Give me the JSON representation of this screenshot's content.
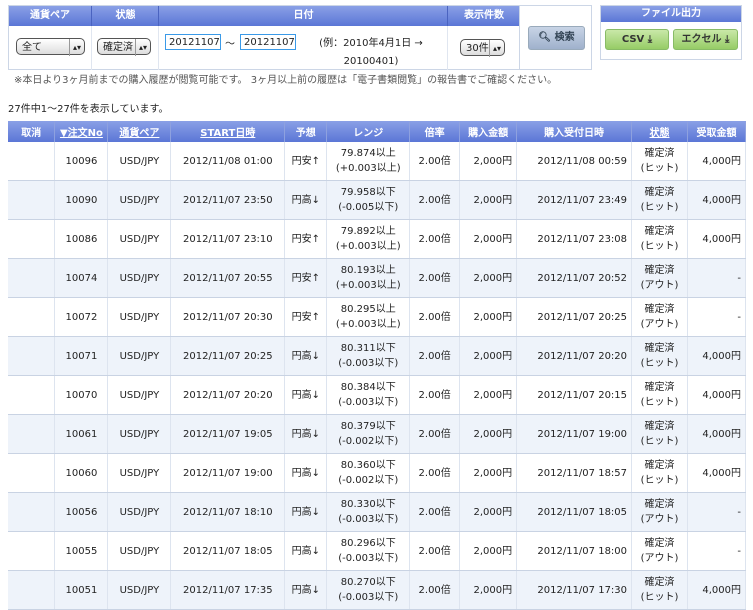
{
  "filter": {
    "headers": [
      "通貨ペア",
      "状態",
      "日付",
      "表示件数"
    ],
    "pair": "全て",
    "status": "確定済",
    "date_from": "20121107",
    "tilde": "〜",
    "date_to": "20121107",
    "example": "(例：2010年4月1日 → 20100401)",
    "count": "30件",
    "search": "検索"
  },
  "export": {
    "title": "ファイル出力",
    "csv": "CSV",
    "excel": "エクセル"
  },
  "note": "※本日より3ヶ月前までの購入履歴が閲覧可能です。 3ヶ月以上前の履歴は「電子書類閲覧」の報告書でご確認ください。",
  "summary": "27件中1〜27件を表示しています。",
  "columns": [
    "取消",
    "▼注文No",
    "通貨ペア",
    "START日時",
    "予想",
    "レンジ",
    "倍率",
    "購入金額",
    "購入受付日時",
    "状態",
    "受取金額"
  ],
  "rows": [
    [
      "",
      "10096",
      "USD/JPY",
      "2012/11/08 01:00",
      "円安↑",
      "79.874以上",
      "(+0.003以上)",
      "2.00倍",
      "2,000円",
      "2012/11/08 00:59",
      "確定済",
      "(ヒット)",
      "4,000円"
    ],
    [
      "",
      "10090",
      "USD/JPY",
      "2012/11/07 23:50",
      "円高↓",
      "79.958以下",
      "(-0.005以下)",
      "2.00倍",
      "2,000円",
      "2012/11/07 23:49",
      "確定済",
      "(ヒット)",
      "4,000円"
    ],
    [
      "",
      "10086",
      "USD/JPY",
      "2012/11/07 23:10",
      "円安↑",
      "79.892以上",
      "(+0.003以上)",
      "2.00倍",
      "2,000円",
      "2012/11/07 23:08",
      "確定済",
      "(ヒット)",
      "4,000円"
    ],
    [
      "",
      "10074",
      "USD/JPY",
      "2012/11/07 20:55",
      "円安↑",
      "80.193以上",
      "(+0.003以上)",
      "2.00倍",
      "2,000円",
      "2012/11/07 20:52",
      "確定済",
      "(アウト)",
      "-"
    ],
    [
      "",
      "10072",
      "USD/JPY",
      "2012/11/07 20:30",
      "円安↑",
      "80.295以上",
      "(+0.003以上)",
      "2.00倍",
      "2,000円",
      "2012/11/07 20:25",
      "確定済",
      "(アウト)",
      "-"
    ],
    [
      "",
      "10071",
      "USD/JPY",
      "2012/11/07 20:25",
      "円高↓",
      "80.311以下",
      "(-0.003以下)",
      "2.00倍",
      "2,000円",
      "2012/11/07 20:20",
      "確定済",
      "(ヒット)",
      "4,000円"
    ],
    [
      "",
      "10070",
      "USD/JPY",
      "2012/11/07 20:20",
      "円高↓",
      "80.384以下",
      "(-0.003以下)",
      "2.00倍",
      "2,000円",
      "2012/11/07 20:15",
      "確定済",
      "(ヒット)",
      "4,000円"
    ],
    [
      "",
      "10061",
      "USD/JPY",
      "2012/11/07 19:05",
      "円高↓",
      "80.379以下",
      "(-0.002以下)",
      "2.00倍",
      "2,000円",
      "2012/11/07 19:00",
      "確定済",
      "(ヒット)",
      "4,000円"
    ],
    [
      "",
      "10060",
      "USD/JPY",
      "2012/11/07 19:00",
      "円高↓",
      "80.360以下",
      "(-0.002以下)",
      "2.00倍",
      "2,000円",
      "2012/11/07 18:57",
      "確定済",
      "(ヒット)",
      "4,000円"
    ],
    [
      "",
      "10056",
      "USD/JPY",
      "2012/11/07 18:10",
      "円高↓",
      "80.330以下",
      "(-0.003以下)",
      "2.00倍",
      "2,000円",
      "2012/11/07 18:05",
      "確定済",
      "(アウト)",
      "-"
    ],
    [
      "",
      "10055",
      "USD/JPY",
      "2012/11/07 18:05",
      "円高↓",
      "80.296以下",
      "(-0.003以下)",
      "2.00倍",
      "2,000円",
      "2012/11/07 18:00",
      "確定済",
      "(アウト)",
      "-"
    ],
    [
      "",
      "10051",
      "USD/JPY",
      "2012/11/07 17:35",
      "円高↓",
      "80.270以下",
      "(-0.003以下)",
      "2.00倍",
      "2,000円",
      "2012/11/07 17:30",
      "確定済",
      "(ヒット)",
      "4,000円"
    ]
  ]
}
